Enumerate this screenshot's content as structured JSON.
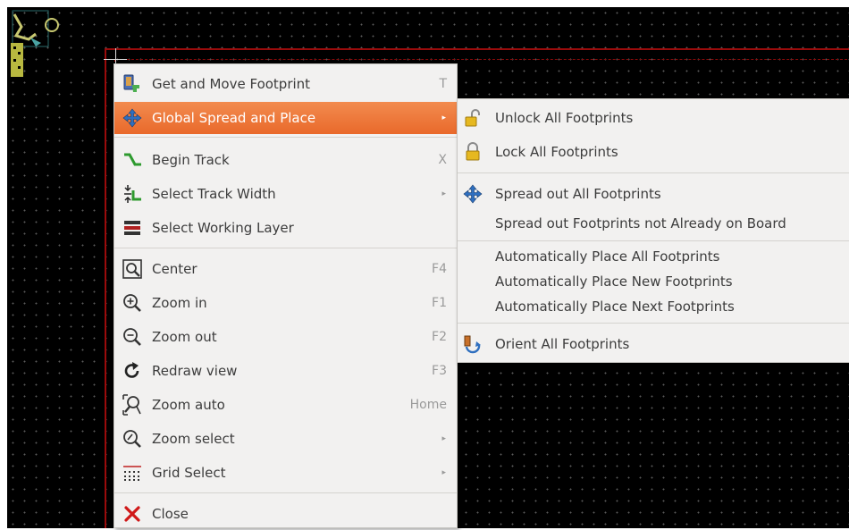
{
  "context_menu": {
    "items": [
      {
        "label": "Get and Move Footprint",
        "shortcut": "T",
        "icon": "footprint-move-icon"
      },
      {
        "label": "Global Spread and Place",
        "shortcut": "",
        "icon": "move-arrows-icon",
        "submenu": true,
        "highlighted": true
      },
      {
        "label": "Begin Track",
        "shortcut": "X",
        "icon": "track-icon"
      },
      {
        "label": "Select Track Width",
        "shortcut": "",
        "icon": "track-width-icon",
        "submenu": true
      },
      {
        "label": "Select Working Layer",
        "shortcut": "",
        "icon": "layers-icon"
      },
      {
        "label": "Center",
        "shortcut": "F4",
        "icon": "zoom-center-icon"
      },
      {
        "label": "Zoom in",
        "shortcut": "F1",
        "icon": "zoom-in-icon"
      },
      {
        "label": "Zoom out",
        "shortcut": "F2",
        "icon": "zoom-out-icon"
      },
      {
        "label": "Redraw view",
        "shortcut": "F3",
        "icon": "redraw-icon"
      },
      {
        "label": "Zoom auto",
        "shortcut": "Home",
        "icon": "zoom-auto-icon"
      },
      {
        "label": "Zoom select",
        "shortcut": "",
        "icon": "zoom-select-icon",
        "submenu": true
      },
      {
        "label": "Grid Select",
        "shortcut": "",
        "icon": "grid-icon",
        "submenu": true
      },
      {
        "label": "Close",
        "shortcut": "",
        "icon": "close-icon"
      }
    ]
  },
  "submenu": {
    "items": [
      {
        "label": "Unlock All Footprints",
        "icon": "unlock-icon"
      },
      {
        "label": "Lock All Footprints",
        "icon": "lock-icon"
      },
      {
        "label": "Spread out All Footprints",
        "icon": "move-arrows-icon"
      },
      {
        "label": "Spread out Footprints not Already on Board",
        "icon": ""
      },
      {
        "label": "Automatically Place All Footprints",
        "icon": ""
      },
      {
        "label": "Automatically Place New Footprints",
        "icon": ""
      },
      {
        "label": "Automatically Place Next Footprints",
        "icon": ""
      },
      {
        "label": "Orient All Footprints",
        "icon": "orient-icon"
      }
    ]
  },
  "colors": {
    "highlight": "#e9692b",
    "menu_bg": "#f2f1f0",
    "canvas_bg": "#000000",
    "board_edge": "#9a0b0b"
  },
  "arrow_glyph": "▸"
}
